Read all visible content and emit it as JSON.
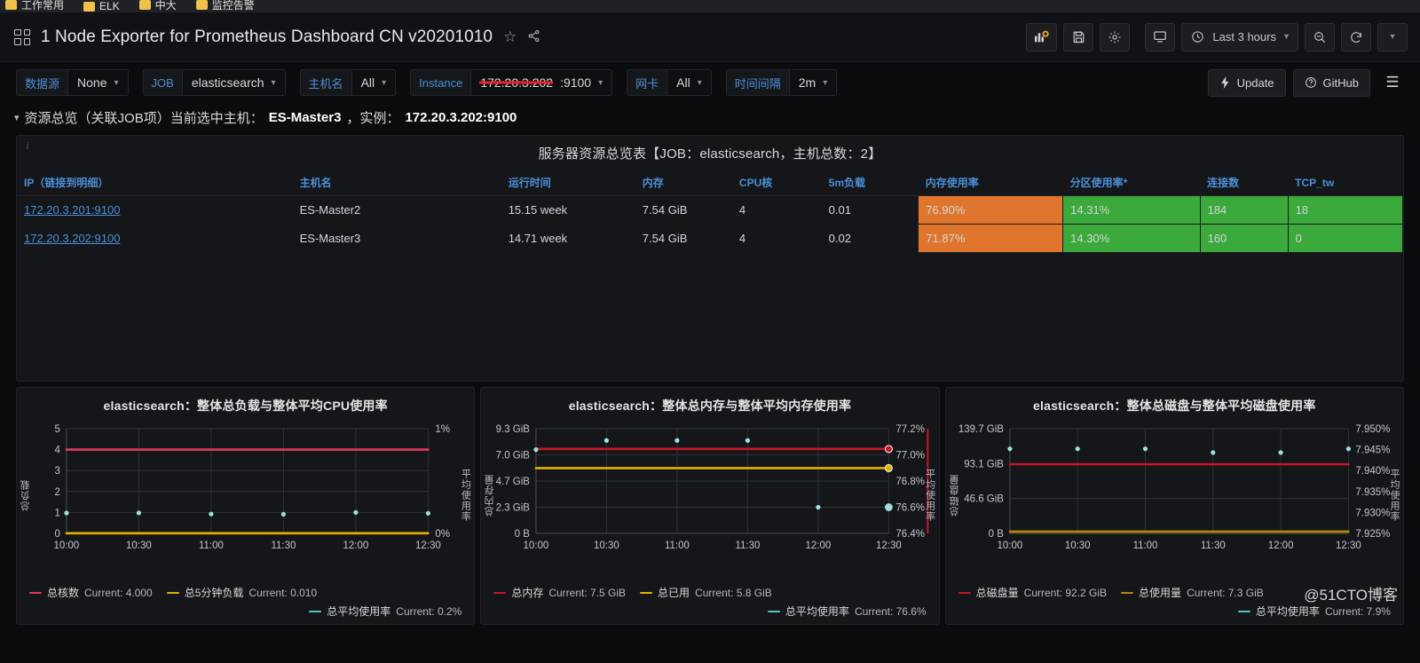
{
  "browser": {
    "bookmarks": [
      "工作常用",
      "ELK",
      "中大",
      "监控告警"
    ]
  },
  "header": {
    "title": "1 Node Exporter for Prometheus Dashboard CN v20201010",
    "star_icon": "star-icon",
    "share_icon": "share-icon",
    "grid_icon": "dashboard-grid-icon",
    "toolbar": {
      "add_panel": "add-panel-icon",
      "save": "save-icon",
      "settings": "gear-icon",
      "tv_mode": "tv-mode-icon",
      "time_range": "Last 3 hours",
      "time_icon": "clock-icon",
      "zoom_out": "zoom-out-icon",
      "refresh": "refresh-icon",
      "refresh_interval_caret": "chevron-down-icon"
    }
  },
  "variables": [
    {
      "label": "数据源",
      "value": "None",
      "name": "datasource"
    },
    {
      "label": "JOB",
      "value": "elasticsearch",
      "name": "job"
    },
    {
      "label": "主机名",
      "value": "All",
      "name": "hostname"
    },
    {
      "label": "Instance",
      "value": "172.20.3.202",
      "suffix": ":9100",
      "redacted": true,
      "name": "instance"
    },
    {
      "label": "网卡",
      "value": "All",
      "name": "nic"
    },
    {
      "label": "时间间隔",
      "value": "2m",
      "name": "interval"
    }
  ],
  "submenu_right": {
    "update_label": "Update",
    "update_icon": "lightning-icon",
    "github_label": "GitHub",
    "github_icon": "question-circle-icon",
    "menu_icon": "hamburger-icon"
  },
  "row": {
    "title_plain": "资源总览（关联JOB项）当前选中主机：",
    "host": "ES-Master3",
    "mid": "，实例：",
    "instance": "172.20.3.202:9100"
  },
  "table_panel": {
    "title": "服务器资源总览表【JOB：elasticsearch，主机总数：2】",
    "info_icon": "info-icon",
    "columns": [
      "IP（链接到明细）",
      "主机名",
      "运行时间",
      "内存",
      "CPU核",
      "5m负载",
      "内存使用率",
      "分区使用率*",
      "连接数",
      "TCP_tw"
    ],
    "rows": [
      {
        "ip": "172.20.3.201:9100",
        "host": "ES-Master2",
        "uptime": "15.15 week",
        "memory": "7.54 GiB",
        "cpu": "4",
        "load5m": "0.01",
        "mem_usage": "76.90%",
        "part_usage": "14.31%",
        "conns": "184",
        "tcp_tw": "18"
      },
      {
        "ip": "172.20.3.202:9100",
        "host": "ES-Master3",
        "uptime": "14.71 week",
        "memory": "7.54 GiB",
        "cpu": "4",
        "load5m": "0.02",
        "mem_usage": "71.87%",
        "part_usage": "14.30%",
        "conns": "160",
        "tcp_tw": "0"
      }
    ],
    "colors": {
      "orange": "#e0752d",
      "green": "#3ba93b",
      "header_blue": "#4d8fd6"
    }
  },
  "chart_data": [
    {
      "type": "line",
      "panel_name": "cpu-load-panel",
      "title": "elasticsearch：整体总负载与整体平均CPU使用率",
      "xlabel": "",
      "ylabel": "总负载",
      "ylabel_right": "平均使用率",
      "x_ticks": [
        "10:00",
        "10:30",
        "11:00",
        "11:30",
        "12:00",
        "12:30"
      ],
      "y_ticks_left": [
        "0",
        "1",
        "2",
        "3",
        "4",
        "5"
      ],
      "y_ticks_right": [
        "0%",
        "1%"
      ],
      "ylim": [
        0,
        5
      ],
      "ylim_right": [
        0,
        1
      ],
      "grid": true,
      "series": [
        {
          "name": "总核数",
          "color": "#e0395e",
          "current_label": "Current: 4.000",
          "axis": "left",
          "style": "line",
          "values": [
            4,
            4,
            4,
            4,
            4,
            4
          ]
        },
        {
          "name": "总5分钟负载",
          "color": "#e0b400",
          "current_label": "Current: 0.010",
          "axis": "left",
          "style": "line",
          "values": [
            0.01,
            0.01,
            0.01,
            0.01,
            0.01,
            0.01
          ]
        },
        {
          "name": "总平均使用率",
          "color": "#56c5c2",
          "current_label": "Current: 0.2%",
          "axis": "right",
          "style": "points",
          "values": [
            0.195,
            0.196,
            0.185,
            0.183,
            0.2,
            0.192
          ]
        }
      ]
    },
    {
      "type": "line",
      "panel_name": "memory-panel",
      "title": "elasticsearch：整体总内存与整体平均内存使用率",
      "xlabel": "",
      "ylabel": "总内存量",
      "ylabel_right": "平均使用率",
      "x_ticks": [
        "10:00",
        "10:30",
        "11:00",
        "11:30",
        "12:00",
        "12:30"
      ],
      "y_ticks_left": [
        "0 B",
        "2.3 GiB",
        "4.7 GiB",
        "7.0 GiB",
        "9.3 GiB"
      ],
      "y_ticks_right": [
        "76.4%",
        "76.6%",
        "76.8%",
        "77.0%",
        "77.2%"
      ],
      "ylim": [
        0,
        9.3
      ],
      "ylim_right": [
        76.4,
        77.2
      ],
      "grid": true,
      "series": [
        {
          "name": "总内存",
          "color": "#c4162a",
          "current_label": "Current: 7.5 GiB",
          "axis": "left",
          "style": "line",
          "values": [
            7.5,
            7.5,
            7.5,
            7.5,
            7.5,
            7.5
          ]
        },
        {
          "name": "总已用",
          "color": "#e0b400",
          "current_label": "Current: 5.8 GiB",
          "axis": "left",
          "style": "line",
          "values": [
            5.8,
            5.8,
            5.8,
            5.8,
            5.8,
            5.8
          ]
        },
        {
          "name": "总平均使用率",
          "color": "#56c5c2",
          "current_label": "Current: 76.6%",
          "axis": "right",
          "style": "points",
          "values": [
            77.04,
            77.11,
            77.11,
            77.11,
            76.6,
            76.6
          ]
        }
      ]
    },
    {
      "type": "line",
      "panel_name": "disk-panel",
      "title": "elasticsearch：整体总磁盘与整体平均磁盘使用率",
      "xlabel": "",
      "ylabel": "总磁盘量",
      "ylabel_right": "平均使用率",
      "x_ticks": [
        "10:00",
        "10:30",
        "11:00",
        "11:30",
        "12:00",
        "12:30"
      ],
      "y_ticks_left": [
        "0 B",
        "46.6 GiB",
        "93.1 GiB",
        "139.7 GiB"
      ],
      "y_ticks_right": [
        "7.925%",
        "7.930%",
        "7.935%",
        "7.940%",
        "7.945%",
        "7.950%"
      ],
      "ylim": [
        0,
        139.7
      ],
      "ylim_right": [
        7.925,
        7.95
      ],
      "grid": true,
      "series": [
        {
          "name": "总磁盘量",
          "color": "#c4162a",
          "current_label": "Current: 92.2 GiB",
          "axis": "left",
          "style": "line",
          "values": [
            92.2,
            92.2,
            92.2,
            92.2,
            92.2,
            92.2
          ]
        },
        {
          "name": "总使用量",
          "color": "#b8860b",
          "current_label": "Current: 7.3 GiB",
          "axis": "left",
          "style": "line",
          "values": [
            2.5,
            2.5,
            2.5,
            2.5,
            2.5,
            2.5
          ]
        },
        {
          "name": "总平均使用率",
          "color": "#56c5c2",
          "current_label": "Current: 7.9%",
          "axis": "right",
          "style": "points",
          "values": [
            7.9452,
            7.9452,
            7.9452,
            7.9443,
            7.9443,
            7.9452
          ]
        }
      ]
    }
  ],
  "watermark": "@51CTO博客"
}
